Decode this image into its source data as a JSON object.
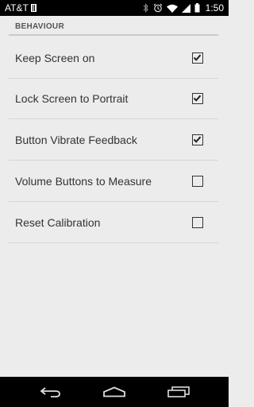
{
  "status_bar": {
    "carrier": "AT&T",
    "time": "1:50",
    "icons": [
      "sim-icon",
      "bluetooth-icon",
      "alarm-icon",
      "wifi-icon",
      "signal-icon",
      "battery-icon"
    ]
  },
  "settings": {
    "section_title": "BEHAVIOUR",
    "items": [
      {
        "label": "Keep Screen on",
        "checked": true
      },
      {
        "label": "Lock Screen to Portrait",
        "checked": true
      },
      {
        "label": "Button Vibrate Feedback",
        "checked": true
      },
      {
        "label": "Volume Buttons to Measure",
        "checked": false
      },
      {
        "label": "Reset Calibration",
        "checked": false
      }
    ]
  },
  "nav_bar": {
    "icons": [
      "back-icon",
      "home-icon",
      "recents-icon"
    ]
  }
}
